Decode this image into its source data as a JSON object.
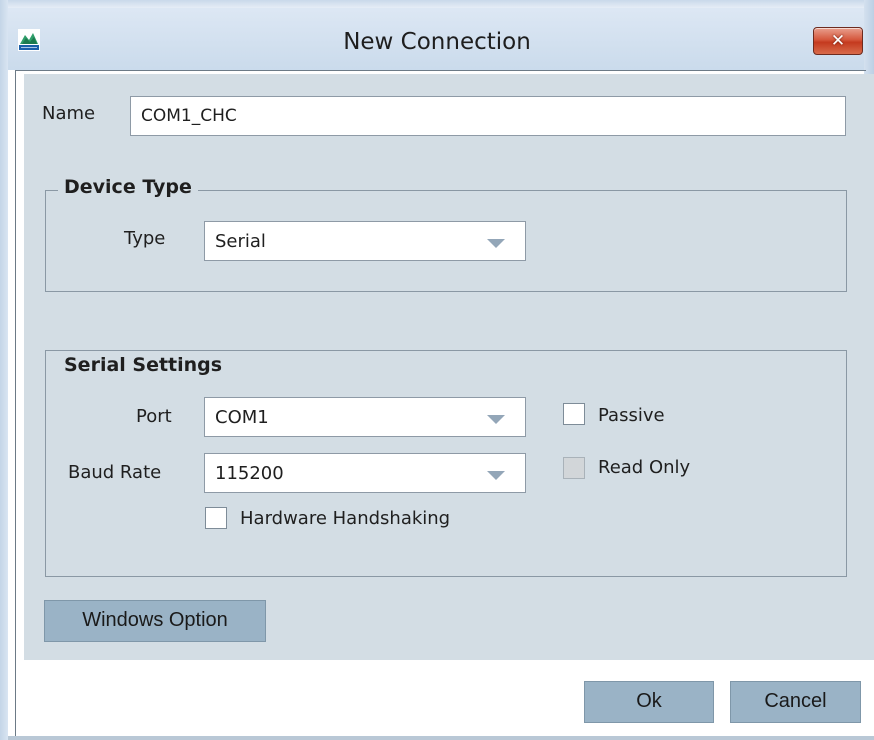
{
  "window": {
    "title": "New Connection",
    "app_icon": "novatel-logo-icon",
    "close_icon": "close-icon",
    "close_glyph": "✕",
    "close_color": "#d5573c"
  },
  "name_field": {
    "label": "Name",
    "value": "COM1_CHC"
  },
  "device_type": {
    "legend": "Device Type",
    "type_label": "Type",
    "type_value": "Serial"
  },
  "serial_settings": {
    "legend": "Serial Settings",
    "port_label": "Port",
    "port_value": "COM1",
    "baud_label": "Baud Rate",
    "baud_value": "115200",
    "passive_label": "Passive",
    "passive_checked": false,
    "read_only_label": "Read Only",
    "read_only_checked": false,
    "read_only_disabled": true,
    "hardware_handshaking_label": "Hardware Handshaking",
    "hardware_handshaking_checked": false
  },
  "buttons": {
    "windows_option": "Windows Option",
    "ok": "Ok",
    "cancel": "Cancel"
  },
  "colors": {
    "panel_bg": "#d3dde4",
    "button_bg": "#9ab3c6",
    "caret": "#93a6b8"
  }
}
